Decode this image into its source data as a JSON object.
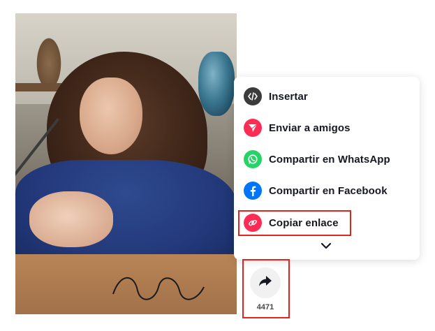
{
  "share_menu": {
    "items": [
      {
        "label": "Insertar",
        "icon": "embed-code-icon",
        "color": "#3b3b3b"
      },
      {
        "label": "Enviar a amigos",
        "icon": "send-paper-plane-icon",
        "color": "#fe2c55"
      },
      {
        "label": "Compartir en WhatsApp",
        "icon": "whatsapp-icon",
        "color": "#25d366"
      },
      {
        "label": "Compartir en Facebook",
        "icon": "facebook-icon",
        "color": "#0075fa"
      },
      {
        "label": "Copiar enlace",
        "icon": "link-icon",
        "color": "#fe2c55"
      }
    ],
    "expand_icon": "chevron-down-icon"
  },
  "share_action": {
    "icon": "share-arrow-icon",
    "count": "4471"
  },
  "highlight_color": "#e0251f"
}
